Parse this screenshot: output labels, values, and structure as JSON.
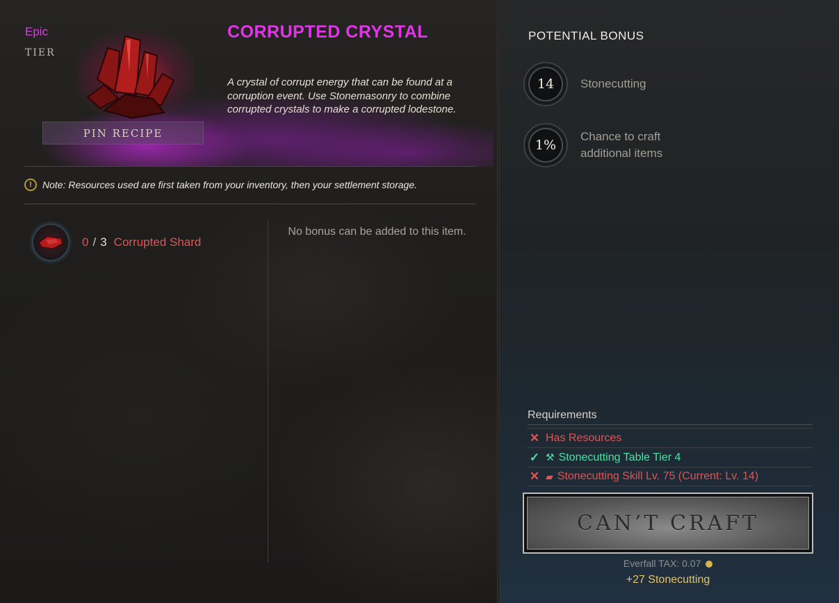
{
  "item": {
    "rarity": "Epic",
    "tier_label": "TIER",
    "pin_recipe_label": "PIN RECIPE",
    "title": "CORRUPTED CRYSTAL",
    "description": "A crystal of corrupt energy that can be found at a corruption event. Use Stonemasonry to combine corrupted crystals to make a corrupted lodestone.",
    "rarity_color": "#d63fe0",
    "icon": "corrupted-crystal-icon"
  },
  "note": {
    "icon": "warning-icon",
    "text": "Note: Resources used are first taken from your inventory, then your settlement storage."
  },
  "resources": [
    {
      "have": "0",
      "sep": "/",
      "need": "3",
      "name": "Corrupted Shard",
      "icon": "corrupted-shard-icon"
    }
  ],
  "no_bonus_text": "No bonus can be added to this item.",
  "potential_bonus": {
    "title": "POTENTIAL BONUS",
    "items": [
      {
        "value": "14",
        "label": "Stonecutting"
      },
      {
        "value": "1%",
        "label": "Chance to craft additional items"
      }
    ]
  },
  "requirements": {
    "title": "Requirements",
    "items": [
      {
        "status": "fail",
        "mark": "✕",
        "icon": "",
        "text": "Has Resources"
      },
      {
        "status": "ok",
        "mark": "✓",
        "icon": "hammer-icon",
        "text": "Stonecutting Table Tier 4"
      },
      {
        "status": "fail",
        "mark": "✕",
        "icon": "skill-icon",
        "text": "Stonecutting Skill Lv. 75 (Current: Lv. 14)"
      }
    ]
  },
  "craft": {
    "button_label": "CAN’T CRAFT",
    "tax_label": "Everfall TAX:",
    "tax_value": "0.07",
    "xp_text": "+27 Stonecutting"
  },
  "colors": {
    "title": "#e433ea",
    "fail": "#e05454",
    "ok": "#4fe0a6",
    "xp": "#e3c46a"
  }
}
